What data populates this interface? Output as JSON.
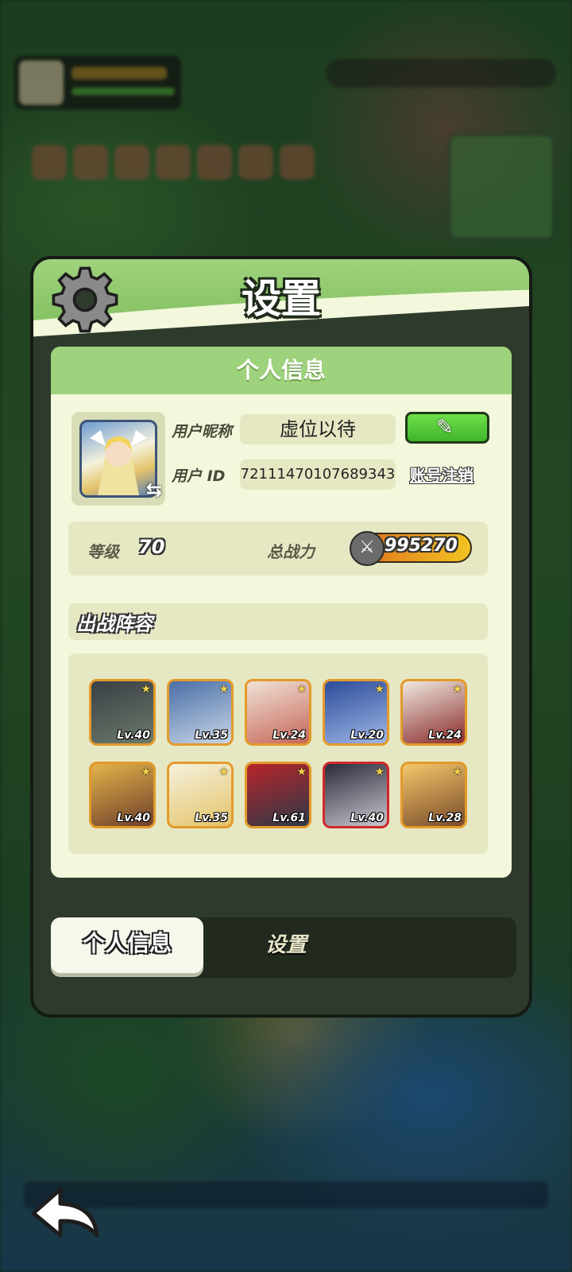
{
  "panel": {
    "title": "设置",
    "section_title": "个人信息",
    "nickname_label": "用户昵称",
    "nickname_value": "虚位以待",
    "id_label": "用户 ID",
    "id_value": "72111470107689343",
    "cancel_account": "账号注销",
    "level_label": "等级",
    "level_value": "70",
    "power_label": "总战力",
    "power_value": "995270",
    "lineup_title": "出战阵容"
  },
  "heroes": [
    {
      "level": "Lv.40",
      "frame": "gold"
    },
    {
      "level": "Lv.35",
      "frame": "gold"
    },
    {
      "level": "Lv.24",
      "frame": "gold"
    },
    {
      "level": "Lv.20",
      "frame": "gold"
    },
    {
      "level": "Lv.24",
      "frame": "gold"
    },
    {
      "level": "Lv.40",
      "frame": "gold"
    },
    {
      "level": "Lv.35",
      "frame": "gold"
    },
    {
      "level": "Lv.61",
      "frame": "gold"
    },
    {
      "level": "Lv.40",
      "frame": "red"
    },
    {
      "level": "Lv.28",
      "frame": "gold"
    }
  ],
  "tabs": {
    "active": "个人信息",
    "inactive": "设置"
  },
  "colors": {
    "header_green": "#9fd27c",
    "content_bg": "#f3f8dc",
    "edit_green": "#3fb52a"
  }
}
